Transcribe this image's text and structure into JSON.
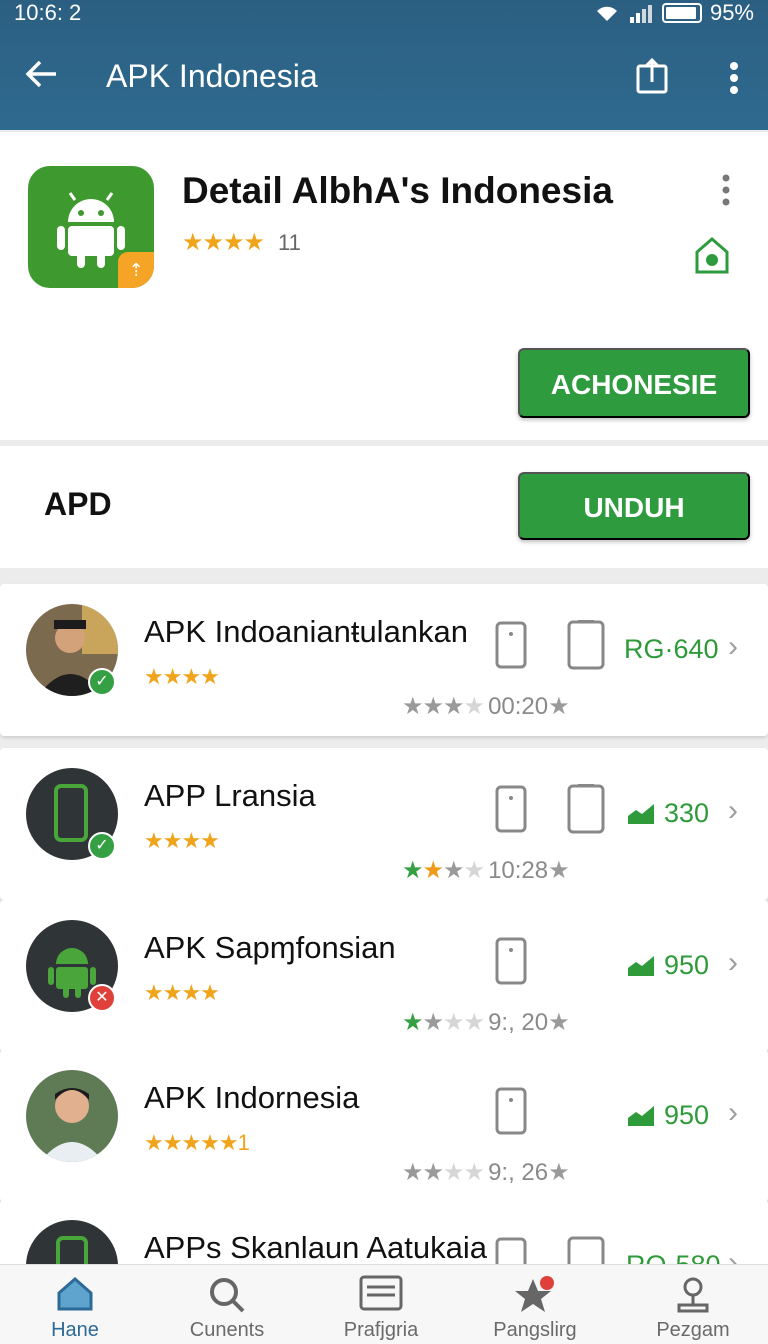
{
  "status_bar": {
    "time": "10:6: 2",
    "battery": "95%"
  },
  "app_bar": {
    "title": "APK Indonesia",
    "back_icon": "arrow-left-icon",
    "share_icon": "share-icon",
    "more_icon": "more-vert-icon"
  },
  "header": {
    "title": "Detail AlbhA's Indonesia",
    "rating_stars": "★★★★",
    "rating_count": "11",
    "badge_glyph": "⇡",
    "install_label": "ACHONESIE"
  },
  "apd": {
    "label": "APD",
    "download_label": "UNDUH"
  },
  "list": [
    {
      "title": "APK Indoanianŧulankan",
      "stars": "★★★★",
      "price": "RG·640",
      "sub_stars": "★★★★",
      "sub_text": "00:20",
      "avatar": "person",
      "badge": "✓",
      "badge_color": "#35a043"
    },
    {
      "title": "APP Lransia",
      "stars": "★★★★",
      "price": "330",
      "sub_stars": "★★★★",
      "sub_text": "10:28",
      "avatar": "phone",
      "badge": "✓",
      "badge_color": "#35a043"
    },
    {
      "title": "APK Sapɱfonsian",
      "stars": "★★★★",
      "price": "950",
      "sub_stars": "★★★★",
      "sub_text": "9:, 20",
      "avatar": "android",
      "badge": "✕",
      "badge_color": "#e0403a"
    },
    {
      "title": "APK Indornesia",
      "stars": "★★★★★1",
      "price": "950",
      "sub_stars": "★★★★",
      "sub_text": "9:, 26",
      "avatar": "person2",
      "badge": "",
      "badge_color": ""
    },
    {
      "title": "APPs Skanlaun Aatukaia",
      "stars": "",
      "price": "RQ·580",
      "sub_stars": "",
      "sub_text": "",
      "avatar": "phone",
      "badge": "",
      "badge_color": ""
    }
  ],
  "bottom_nav": [
    {
      "label": "Hane",
      "icon": "home-icon"
    },
    {
      "label": "Cunents",
      "icon": "search-icon"
    },
    {
      "label": "Prafjgria",
      "icon": "list-icon"
    },
    {
      "label": "Pangslirg",
      "icon": "star-icon"
    },
    {
      "label": "Pezgam",
      "icon": "profile-icon"
    }
  ],
  "colors": {
    "app_bar": "#2f6a8f",
    "accent_green": "#2e9b3f",
    "star": "#f0a41c"
  }
}
